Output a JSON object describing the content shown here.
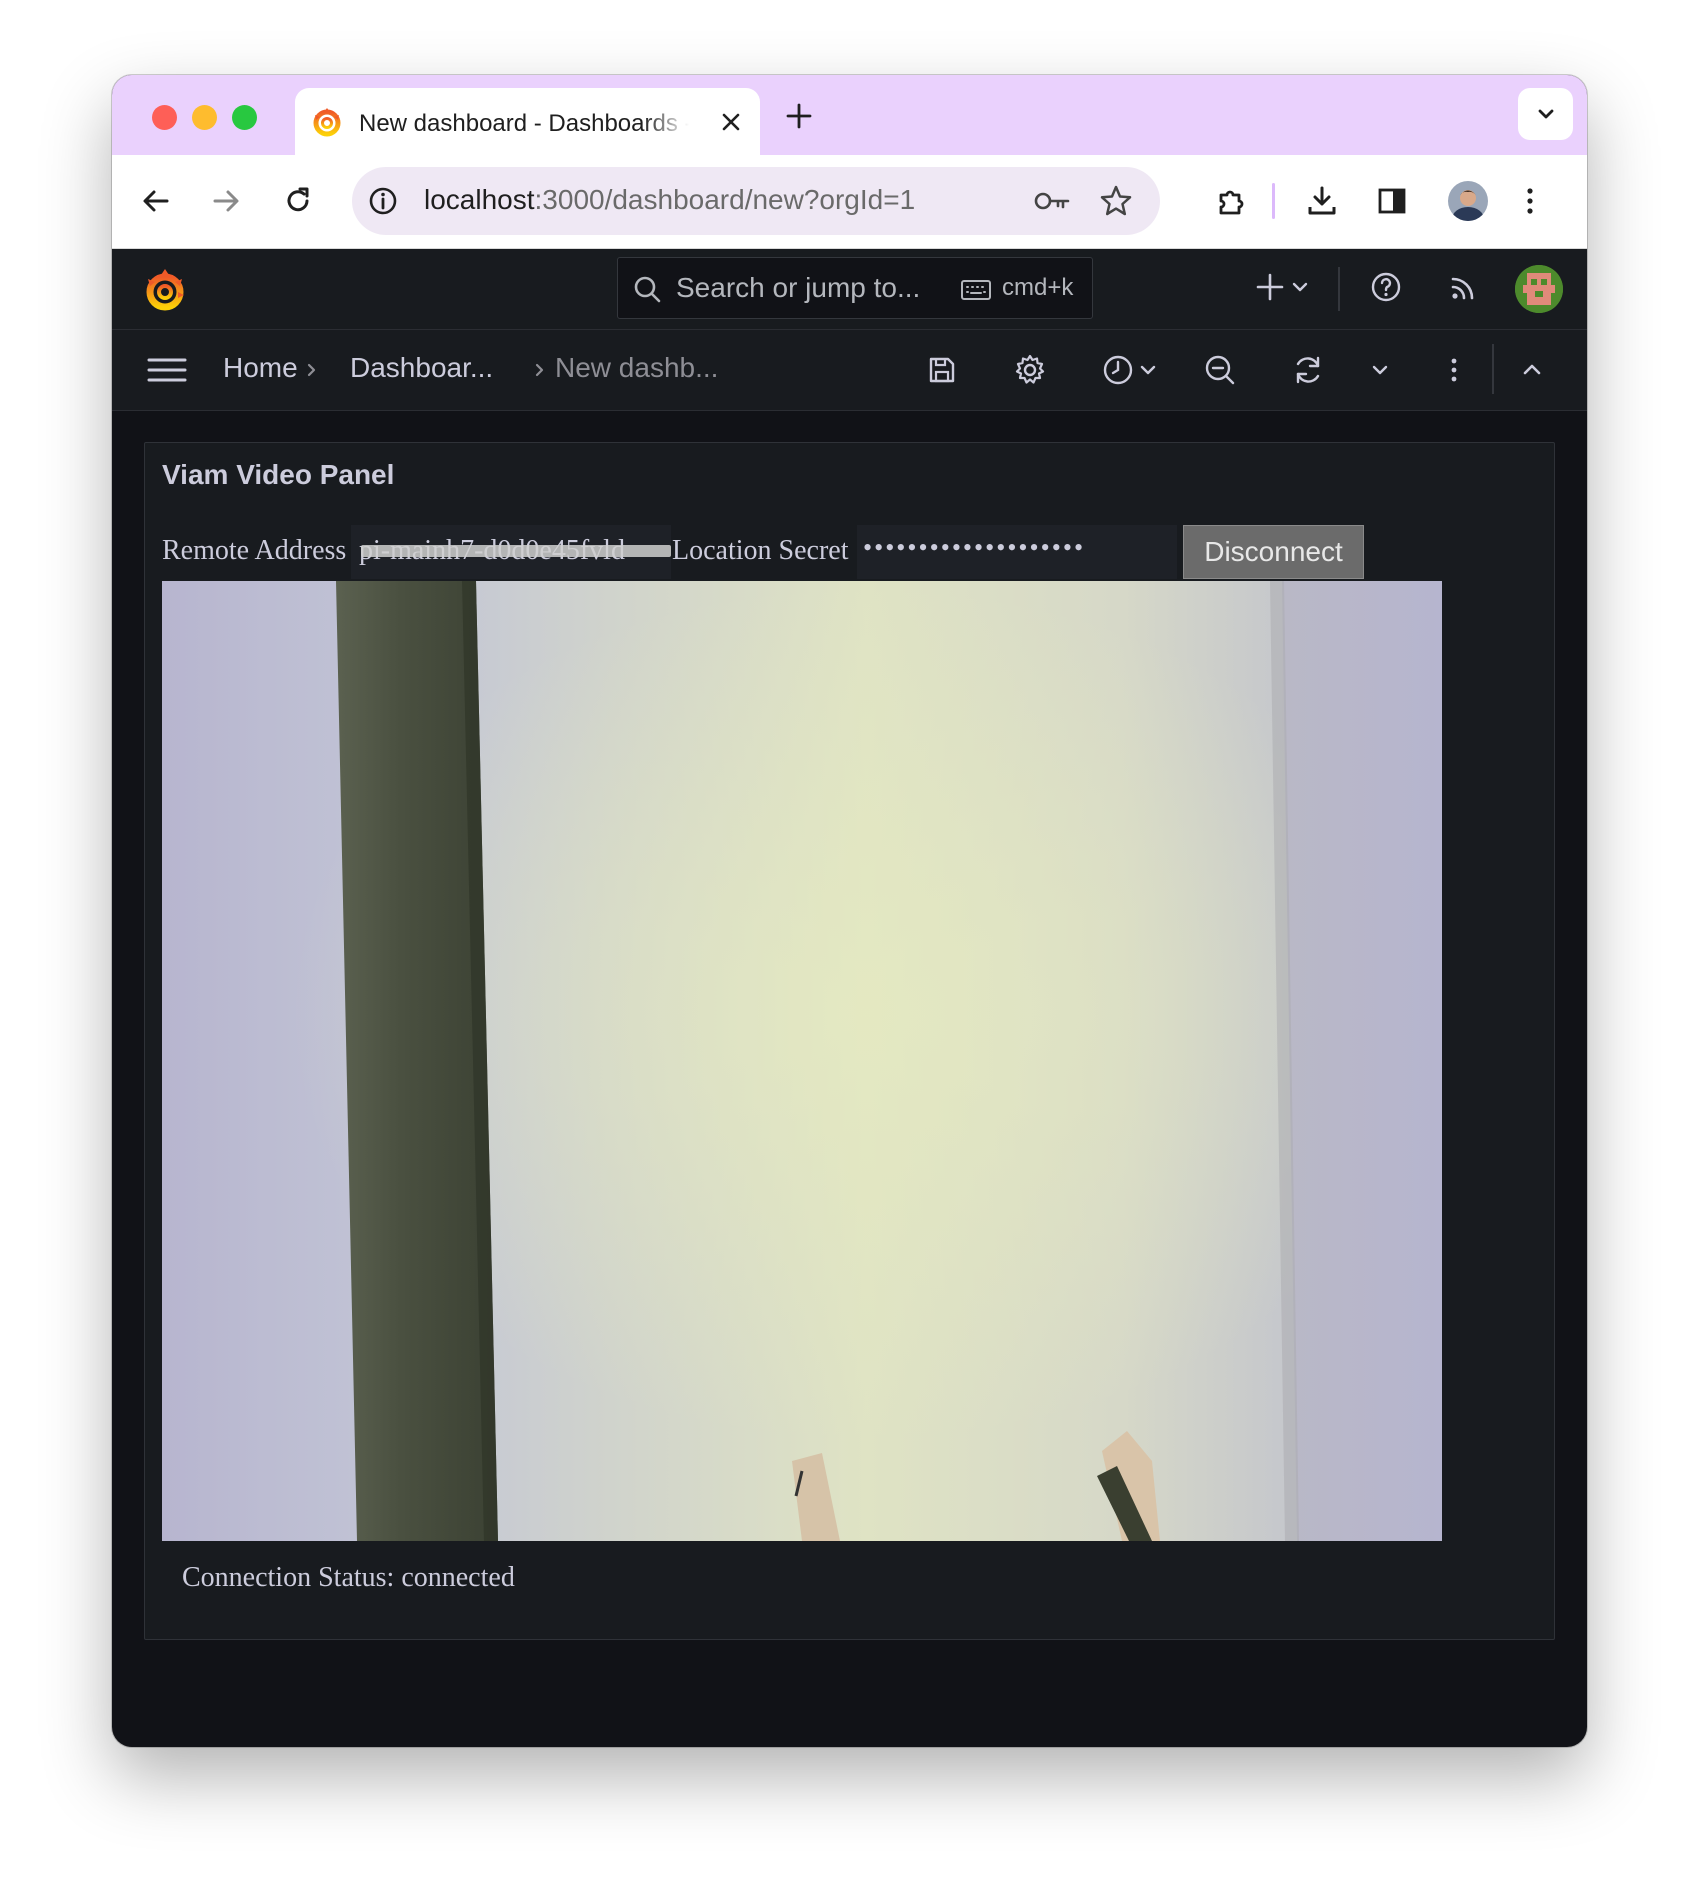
{
  "browser": {
    "tab": {
      "title": "New dashboard - Dashboards - Grafana"
    },
    "address": {
      "host": "localhost",
      "rest": ":3000/dashboard/new?orgId=1"
    }
  },
  "grafana": {
    "search": {
      "placeholder": "Search or jump to...",
      "shortcut": "cmd+k"
    },
    "breadcrumb": [
      "Home",
      "Dashboar...",
      "New dashb..."
    ]
  },
  "panel": {
    "title": "Viam Video Panel",
    "remote_address_label": "Remote Address",
    "remote_address_value": "pi-mainh7-d0d0e45fvld",
    "location_secret_label": "Location Secret",
    "location_secret_value": "••••••••••••••••••••",
    "disconnect_label": "Disconnect",
    "status_text": "Connection Status: connected"
  },
  "icons": [
    "grafana-logo-icon",
    "close-icon",
    "plus-icon",
    "chevron-down-icon",
    "back-icon",
    "forward-icon",
    "reload-icon",
    "info-icon",
    "key-icon",
    "star-icon",
    "extensions-icon",
    "download-icon",
    "side-panel-icon",
    "kebab-icon",
    "search-icon",
    "keyboard-icon",
    "help-icon",
    "rss-icon",
    "menu-icon",
    "chevron-right-icon",
    "save-icon",
    "gear-icon",
    "clock-icon",
    "zoom-out-icon",
    "refresh-icon",
    "chevron-up-icon"
  ],
  "colors": {
    "tab_strip": "#ead1fd",
    "grafana_bg": "#111217",
    "grafana_header": "#181b1f",
    "text": "#ccccdc"
  }
}
